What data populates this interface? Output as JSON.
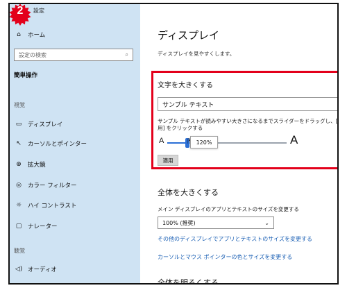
{
  "app": {
    "title": "設定",
    "badge_number": "2"
  },
  "sidebar": {
    "home_label": "ホーム",
    "search_placeholder": "設定の検索",
    "section_title": "簡単操作",
    "group_vision": "視覚",
    "items": [
      {
        "label": "ディスプレイ",
        "icon": "monitor-icon"
      },
      {
        "label": "カーソルとポインター",
        "icon": "cursor-icon"
      },
      {
        "label": "拡大鏡",
        "icon": "magnifier-icon"
      },
      {
        "label": "カラー フィルター",
        "icon": "color-filter-icon"
      },
      {
        "label": "ハイ コントラスト",
        "icon": "high-contrast-icon"
      },
      {
        "label": "ナレーター",
        "icon": "narrator-icon"
      }
    ],
    "group_hearing": "聴覚",
    "audio_item_label": "オーディオ"
  },
  "main": {
    "title": "ディスプレイ",
    "subtitle": "ディスプレイを見やすくします。",
    "text_size": {
      "heading": "文字を大きくする",
      "sample_text": "サンプル テキスト",
      "description": "サンプル テキストが読みやすい大きさになるまでスライダーをドラッグし、[適用] をクリックする",
      "small_a": "A",
      "large_a": "A",
      "slider_value": "120%",
      "slider_fraction": 0.17,
      "apply_label": "適用"
    },
    "everything": {
      "heading": "全体を大きくする",
      "description": "メイン ディスプレイのアプリとテキストのサイズを変更する",
      "select_value": "100% (推奨)",
      "link_other_displays": "その他のディスプレイでアプリとテキストのサイズを変更する",
      "link_cursor": "カーソルとマウス ポインターの色とサイズを変更する"
    },
    "brightness_heading": "全体を明るくする"
  },
  "colors": {
    "sidebar_bg": "#cfe3f3",
    "highlight_border": "#e3001b",
    "link": "#1a5fb4",
    "slider_accent": "#2a6fd6",
    "badge": "#e3001b"
  }
}
